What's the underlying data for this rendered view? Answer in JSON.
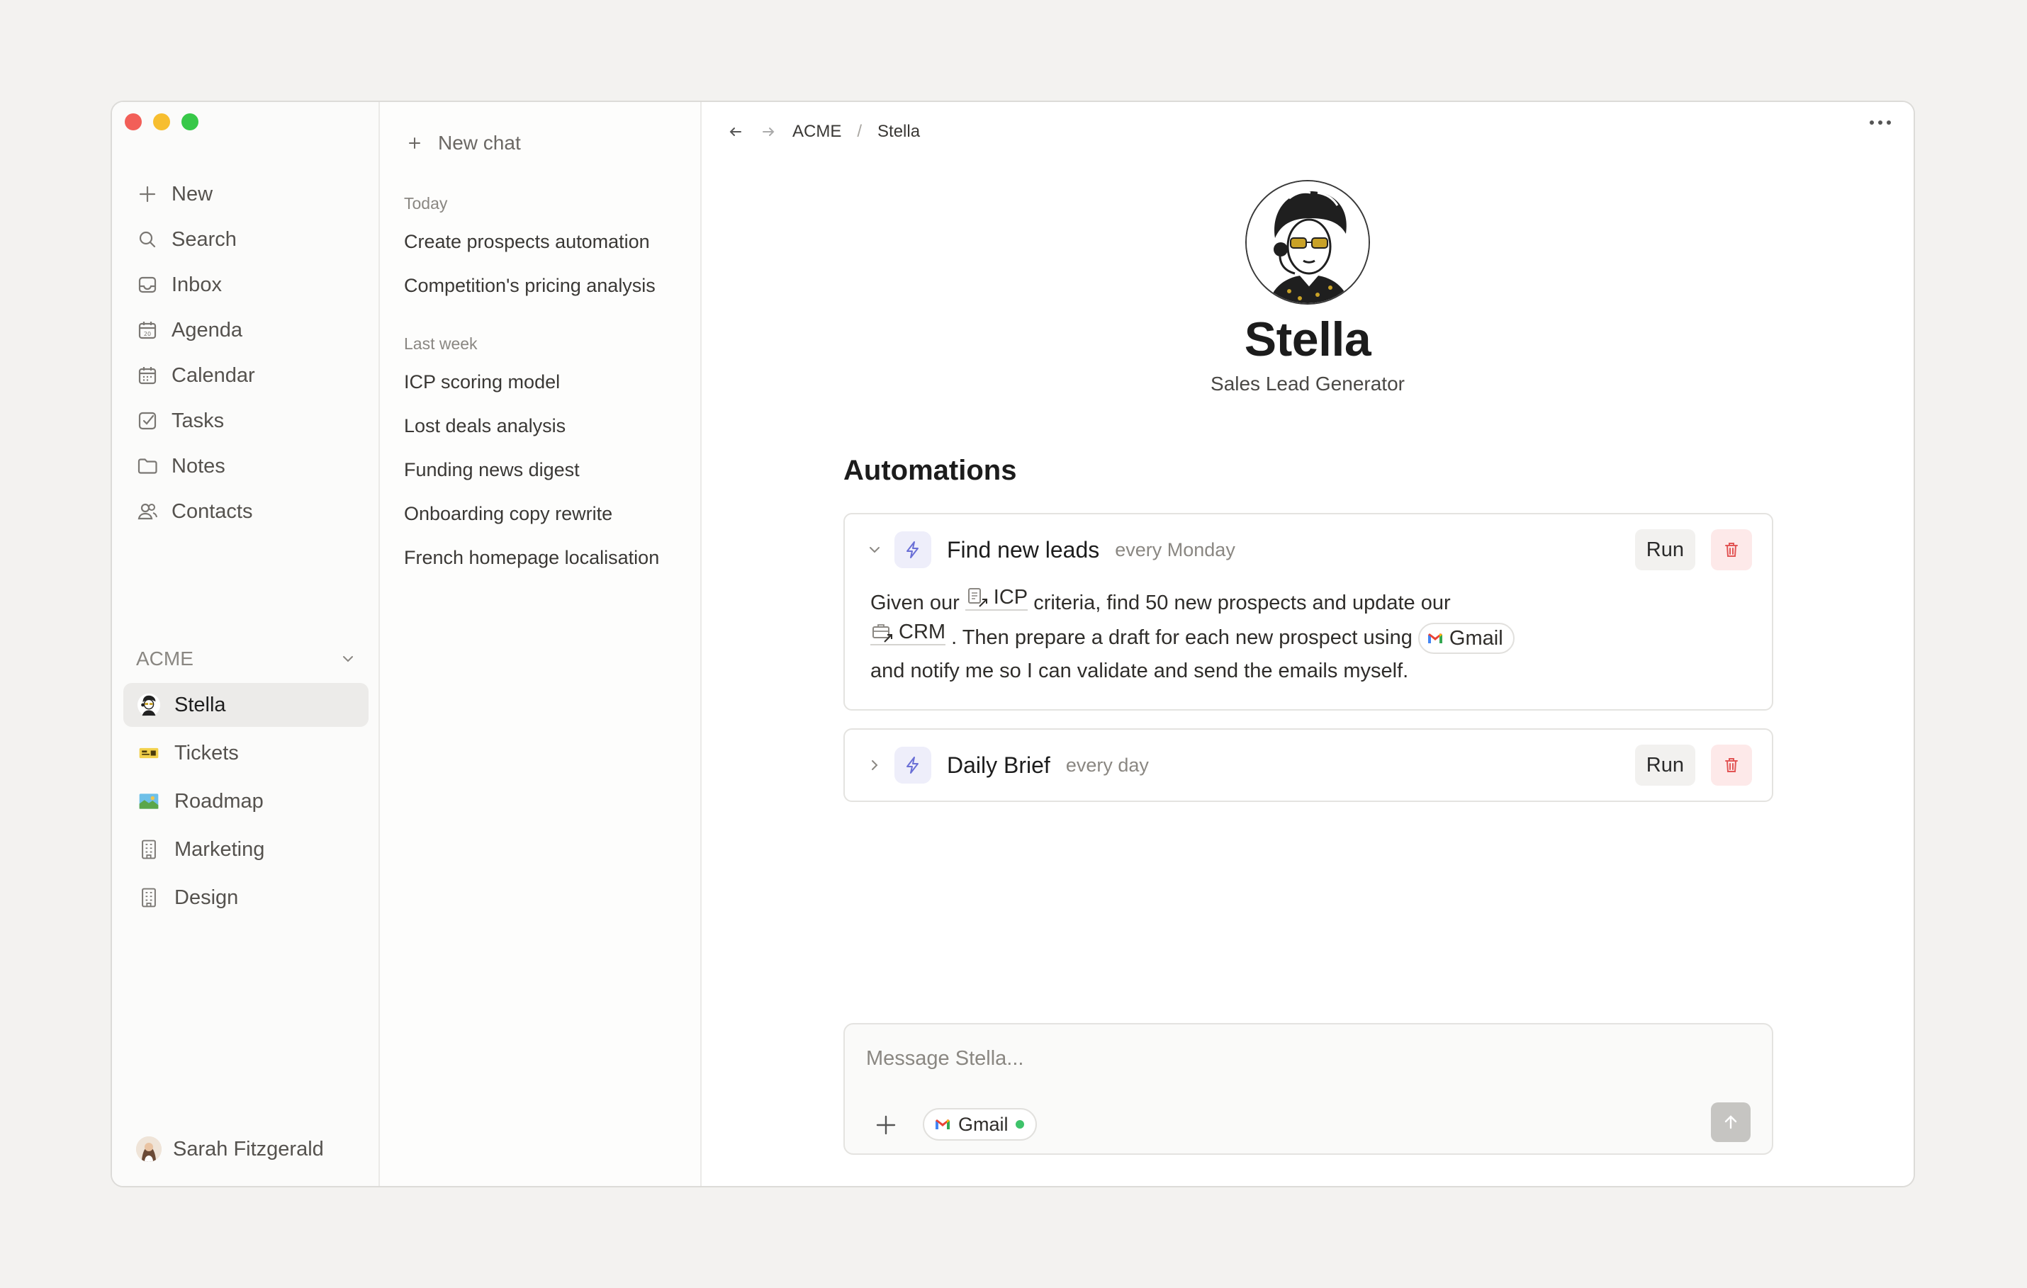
{
  "sidebar": {
    "nav": [
      {
        "label": "New",
        "icon": "plus-icon"
      },
      {
        "label": "Search",
        "icon": "search-icon"
      },
      {
        "label": "Inbox",
        "icon": "inbox-icon"
      },
      {
        "label": "Agenda",
        "icon": "agenda-icon"
      },
      {
        "label": "Calendar",
        "icon": "calendar-icon"
      },
      {
        "label": "Tasks",
        "icon": "tasks-icon"
      },
      {
        "label": "Notes",
        "icon": "folder-icon"
      },
      {
        "label": "Contacts",
        "icon": "contacts-icon"
      }
    ],
    "agenda_day": "20",
    "workspace": "ACME",
    "items": [
      {
        "label": "Stella",
        "icon": "stella-avatar-icon",
        "active": true
      },
      {
        "label": "Tickets",
        "icon": "ticket-icon"
      },
      {
        "label": "Roadmap",
        "icon": "map-icon"
      },
      {
        "label": "Marketing",
        "icon": "building-icon"
      },
      {
        "label": "Design",
        "icon": "building-icon"
      }
    ],
    "user": "Sarah Fitzgerald"
  },
  "chats": {
    "new_chat": "New chat",
    "today_label": "Today",
    "today": [
      "Create prospects automation",
      "Competition's pricing analysis"
    ],
    "last_week_label": "Last week",
    "last_week": [
      "ICP scoring model",
      "Lost deals analysis",
      "Funding news digest",
      "Onboarding copy rewrite",
      "French homepage localisation"
    ]
  },
  "breadcrumb": {
    "root": "ACME",
    "separator": "/",
    "current": "Stella"
  },
  "profile": {
    "name": "Stella",
    "role": "Sales Lead Generator"
  },
  "automations": {
    "title": "Automations",
    "items": [
      {
        "title": "Find new leads",
        "frequency": "every Monday",
        "run": "Run",
        "expanded": true,
        "body": {
          "t1": "Given our",
          "icp": "ICP",
          "t2": "criteria, find 50 new prospects and update our",
          "crm": "CRM",
          "t3": ". Then prepare a draft for each new prospect using",
          "gmail": "Gmail",
          "t4": "and notify me so I can validate and send the emails myself."
        }
      },
      {
        "title": "Daily Brief",
        "frequency": "every day",
        "run": "Run",
        "expanded": false
      }
    ]
  },
  "composer": {
    "placeholder": "Message Stella...",
    "integration": "Gmail",
    "integration_status_color": "#3ec36a"
  },
  "colors": {
    "accent_bolt": "#6a6fd6",
    "danger": "#e25555"
  }
}
